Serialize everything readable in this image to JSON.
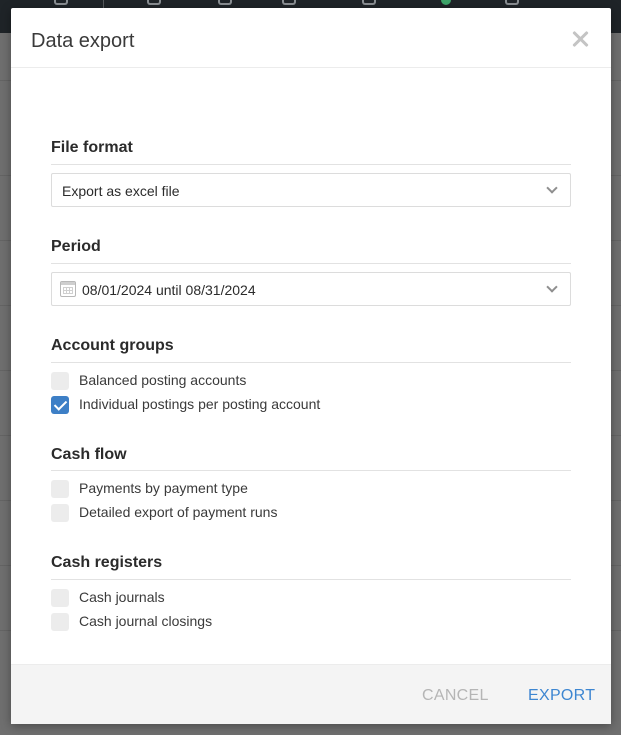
{
  "dialog": {
    "title": "Data export",
    "close_icon": "close-icon"
  },
  "file_format": {
    "title": "File format",
    "selected": "Export as excel file"
  },
  "period": {
    "title": "Period",
    "value": "08/01/2024 until 08/31/2024",
    "icon": "calendar-icon"
  },
  "account_groups": {
    "title": "Account groups",
    "items": [
      {
        "label": "Balanced posting accounts",
        "checked": false
      },
      {
        "label": "Individual postings per posting account",
        "checked": true
      }
    ]
  },
  "cash_flow": {
    "title": "Cash flow",
    "items": [
      {
        "label": "Payments by payment type",
        "checked": false
      },
      {
        "label": "Detailed export of payment runs",
        "checked": false
      }
    ]
  },
  "cash_registers": {
    "title": "Cash registers",
    "items": [
      {
        "label": "Cash journals",
        "checked": false
      },
      {
        "label": "Cash journal closings",
        "checked": false
      }
    ]
  },
  "footer": {
    "cancel_label": "CANCEL",
    "export_label": "EXPORT"
  },
  "colors": {
    "accent": "#3d86d1",
    "checkbox_checked": "#3d7fc6",
    "checkbox_unchecked": "#ececec",
    "cancel_text": "#b5b5b5"
  }
}
